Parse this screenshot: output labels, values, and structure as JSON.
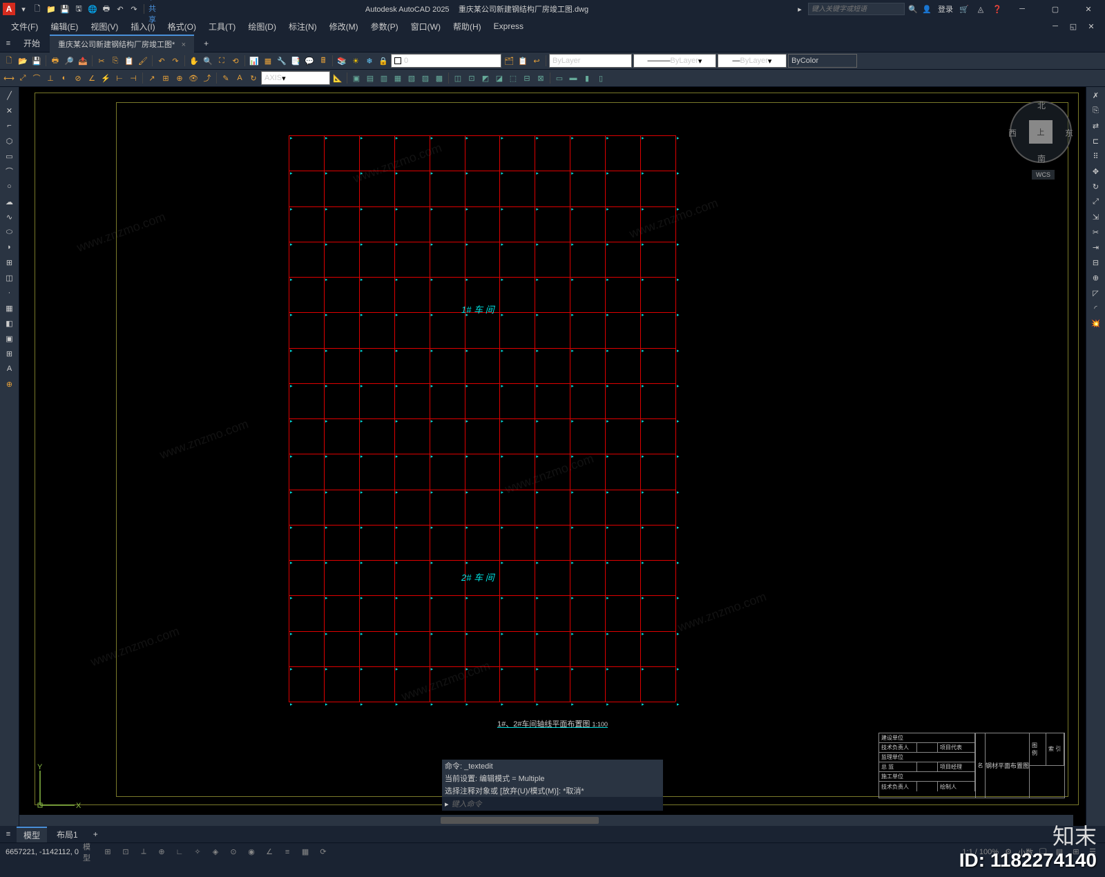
{
  "app": {
    "name": "Autodesk AutoCAD 2025",
    "doc": "重庆某公司新建钢结构厂房竣工图.dwg",
    "logo": "A"
  },
  "search": {
    "placeholder": "键入关键字或短语"
  },
  "login": "登录",
  "menus": [
    "文件(F)",
    "编辑(E)",
    "视图(V)",
    "插入(I)",
    "格式(O)",
    "工具(T)",
    "绘图(D)",
    "标注(N)",
    "修改(M)",
    "参数(P)",
    "窗口(W)",
    "帮助(H)",
    "Express"
  ],
  "tabs": {
    "start": "开始",
    "doc": "重庆某公司新建钢结构厂房竣工图*",
    "add": "+"
  },
  "layer": {
    "current": "0",
    "lw": "ByLayer",
    "lt": "ByLayer",
    "lt2": "ByLayer",
    "color": "ByColor",
    "axis": "AXIS"
  },
  "canvas": {
    "zone1": "1# 车 间",
    "zone2": "2# 车 间",
    "title": "1#、2#车间轴线平面布置图",
    "scale": "1:100",
    "compass": {
      "n": "北",
      "s": "南",
      "e": "东",
      "w": "西",
      "top": "上"
    },
    "wcs": "WCS",
    "tb": {
      "r1": "建设单位",
      "r2a": "技术负责人",
      "r2b": "项目代表",
      "r3": "监理单位",
      "r4a": "总 监",
      "r4b": "项目经理",
      "r5": "施工单位",
      "r6a": "技术负责人",
      "r6b": "绘制人",
      "center": "钢材平面布置图",
      "rt1": "图 例",
      "rt2": "索 引",
      "b": "名"
    }
  },
  "cmd": {
    "l1": "命令: _textedit",
    "l2": "当前设置: 编辑模式 = Multiple",
    "l3": "选择注释对象或 [放弃(U)/模式(M)]: *取消*",
    "prompt": "键入命令",
    "icon": "▸"
  },
  "btabs": {
    "model": "模型",
    "layout": "布局1",
    "add": "+"
  },
  "status": {
    "coord": "6657221, -1142112, 0",
    "model": "模型",
    "scale": "1:1 / 100%",
    "dec": "小数"
  },
  "overlay": {
    "id": "ID: 1182274140",
    "brand": "知末",
    "wm": "www.znzmo.com"
  }
}
